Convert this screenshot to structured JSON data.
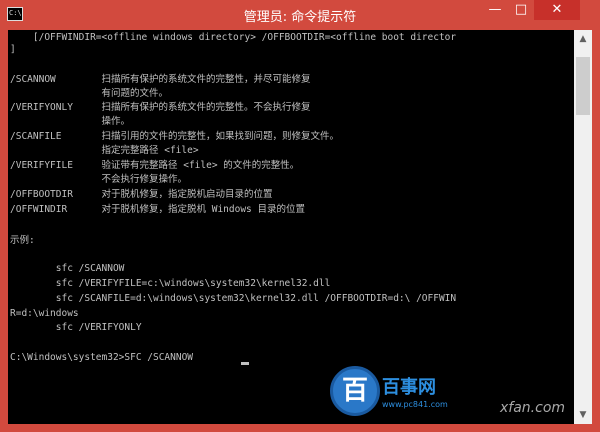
{
  "window": {
    "title": "管理员: 命令提示符",
    "icon_text": "C:\\",
    "min_glyph": "—",
    "max_glyph": "□",
    "close_glyph": "✕"
  },
  "console": {
    "lines": [
      "    [/OFFWINDIR=<offline windows directory> /OFFBOOTDIR=<offline boot director",
      "]",
      "",
      "/SCANNOW        扫描所有保护的系统文件的完整性，并尽可能修复",
      "                有问题的文件。",
      "/VERIFYONLY     扫描所有保护的系统文件的完整性。不会执行修复",
      "                操作。",
      "/SCANFILE       扫描引用的文件的完整性，如果找到问题，则修复文件。",
      "                指定完整路径 <file>",
      "/VERIFYFILE     验证带有完整路径 <file> 的文件的完整性。",
      "                不会执行修复操作。",
      "/OFFBOOTDIR     对于脱机修复，指定脱机启动目录的位置",
      "/OFFWINDIR      对于脱机修复，指定脱机 Windows 目录的位置",
      "",
      "示例:",
      "",
      "        sfc /SCANNOW",
      "        sfc /VERIFYFILE=c:\\windows\\system32\\kernel32.dll",
      "        sfc /SCANFILE=d:\\windows\\system32\\kernel32.dll /OFFBOOTDIR=d:\\ /OFFWIN",
      "R=d:\\windows",
      "        sfc /VERIFYONLY",
      "",
      "C:\\Windows\\system32>SFC /SCANNOW"
    ]
  },
  "scrollbar": {
    "up_glyph": "▲",
    "down_glyph": "▼"
  },
  "overlay": {
    "logo_glyph": "百",
    "logo_name": "百事网",
    "logo_url": "www.pc841.com",
    "watermark": "xfan.com"
  }
}
